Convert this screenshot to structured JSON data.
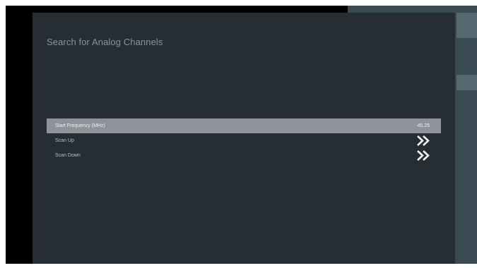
{
  "dialog": {
    "title": "Search for Analog Channels",
    "options": [
      {
        "label": "Start Frequency (MHz)",
        "value": "45.25",
        "selected": true
      },
      {
        "label": "Scan Up",
        "icon": "double-chevron-right-icon"
      },
      {
        "label": "Scan Down",
        "icon": "double-chevron-right-icon"
      }
    ]
  },
  "colors": {
    "dialog_background": "#262d33",
    "selected_row": "#8d9398",
    "side_panel": "#3a4a52"
  }
}
